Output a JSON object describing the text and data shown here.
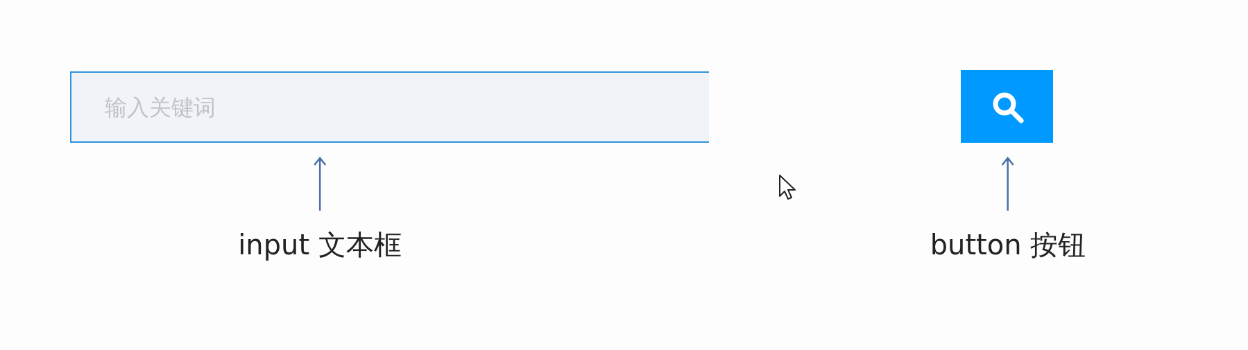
{
  "search_input": {
    "placeholder": "输入关键词"
  },
  "annotations": [
    {
      "label": "input 文本框",
      "kind": "field"
    },
    {
      "label": "button 按钮",
      "kind": "button"
    }
  ]
}
